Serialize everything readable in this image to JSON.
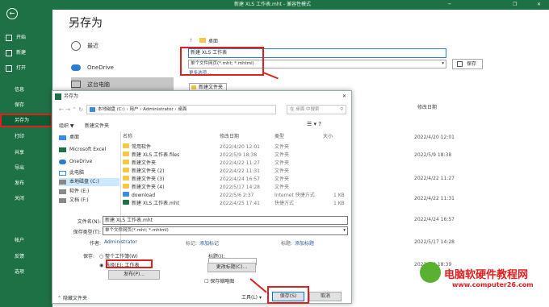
{
  "window": {
    "title": "新建 XLS 工作表.mht  -  兼容性模式"
  },
  "backstage": {
    "page_title": "另存为",
    "menu": [
      {
        "label": "开始"
      },
      {
        "label": "新建"
      },
      {
        "label": "打开"
      },
      {
        "label": "信息"
      },
      {
        "label": "保存"
      },
      {
        "label": "另存为"
      },
      {
        "label": "打印"
      },
      {
        "label": "共享"
      },
      {
        "label": "导出"
      },
      {
        "label": "发布"
      },
      {
        "label": "关闭"
      },
      {
        "label": "帐户"
      },
      {
        "label": "反馈"
      },
      {
        "label": "选项"
      }
    ],
    "locations": [
      {
        "label": "最近"
      },
      {
        "label": "OneDrive"
      },
      {
        "label": "这台电脑"
      }
    ],
    "path_label": "桌面",
    "filename": "新建 XLS 工作表",
    "filetype": "单个文件网页(*.mht; *.mhtml)",
    "more_options": "更多选项...",
    "save_button": "保存",
    "new_folder": "新建文件夹",
    "col_modified": "修改日期",
    "dates": [
      "2022/4/20 12:01",
      "2022/5/9 18:38",
      "2022/4/22 11:27",
      "2022/4/22 11:31",
      "2022/4/24 16:57",
      "2022/5/17 14:28",
      "2022/5/9 18:39"
    ]
  },
  "dialog": {
    "title": "另存为",
    "breadcrumb": [
      "本地磁盘 (C:)",
      "用户",
      "Administrator",
      "桌面"
    ],
    "search_placeholder": "在 桌面 中搜索",
    "organize": "组织 ▼",
    "new_folder": "新建文件夹",
    "nav": [
      {
        "label": "桌面"
      },
      {
        "label": "Microsoft Excel"
      },
      {
        "label": "OneDrive"
      },
      {
        "label": "此电脑"
      },
      {
        "label": "本地磁盘 (C:)"
      },
      {
        "label": "软件 (E:)"
      },
      {
        "label": "文档 (F:)"
      }
    ],
    "cols": {
      "name": "名称",
      "date": "修改日期",
      "type": "类型",
      "size": "大小"
    },
    "rows": [
      {
        "name": "常用软件",
        "date": "2022/4/20 12:01",
        "type": "文件夹",
        "size": ""
      },
      {
        "name": "新建 XLS 工作表.files",
        "date": "2022/5/9 18:38",
        "type": "文件夹",
        "size": ""
      },
      {
        "name": "新建文件夹",
        "date": "2022/4/22 11:27",
        "type": "文件夹",
        "size": ""
      },
      {
        "name": "新建文件夹 (2)",
        "date": "2022/4/22 11:31",
        "type": "文件夹",
        "size": ""
      },
      {
        "name": "新建文件夹 (3)",
        "date": "2022/4/24 16:57",
        "type": "文件夹",
        "size": ""
      },
      {
        "name": "新建文件夹 (4)",
        "date": "2022/5/17 14:28",
        "type": "文件夹",
        "size": ""
      },
      {
        "name": "download",
        "date": "2022/5/6 2:37",
        "type": "Internet 快捷方式",
        "size": "1 KB"
      },
      {
        "name": "新建 XLS 工作表.mht",
        "date": "2022/4/25 17:41",
        "type": "快捷方式",
        "size": "1 KB"
      }
    ],
    "filename_label": "文件名(N):",
    "filename_value": "新建 XLS 工作表.mht",
    "type_label": "保存类型(T):",
    "type_value": "单个文件网页(*.mht; *.mhtml)",
    "author_label": "作者:",
    "author_value": "Administrator",
    "tags_label": "标记:",
    "tags_value": "添加标记",
    "title_label": "标题:",
    "title_value": "添加标题",
    "save_label": "保存:",
    "opt_whole": "整个工作簿(W)",
    "opt_selection": "选择(E): 工作表",
    "publish": "发布(P)...",
    "title_field_label": "标题(I):",
    "change_title": "更改标题(C)...",
    "thumbnail": "保存缩略图",
    "hide_folders": "隐藏文件夹",
    "tools": "工具(L)",
    "save": "保存(S)",
    "cancel": "取消"
  },
  "watermark": {
    "line1": "电脑软硬件教程网",
    "line2": "www.computer26.com"
  },
  "colors": {
    "excel_green": "#1e7145",
    "annotation_red": "#e02020"
  }
}
